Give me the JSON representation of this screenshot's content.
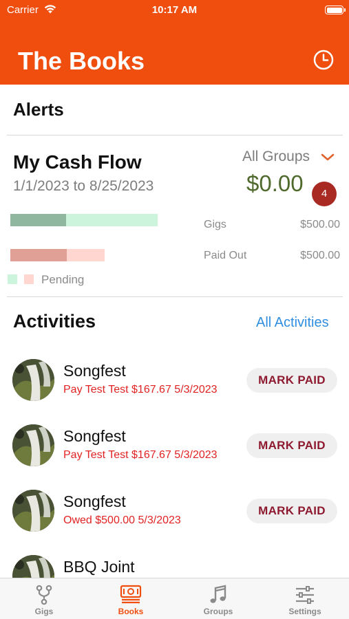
{
  "status_bar": {
    "carrier": "Carrier",
    "time": "10:17 AM"
  },
  "header": {
    "title": "The Books"
  },
  "alerts": {
    "label": "Alerts",
    "count": "4"
  },
  "cash_flow": {
    "title": "My Cash Flow",
    "date_range": "1/1/2023 to 8/25/2023",
    "group_filter": "All Groups",
    "amount": "$0.00",
    "rows": [
      {
        "label": "Gigs",
        "amount": "$500.00",
        "bar_fraction": 1.0,
        "settled_fraction": 0.38,
        "settled_color": "#8fb79f",
        "pending_color": "#ccf3dc"
      },
      {
        "label": "Paid Out",
        "amount": "$500.00",
        "bar_fraction": 0.64,
        "settled_fraction": 0.6,
        "settled_color": "#e0a095",
        "pending_color": "#ffd6d0"
      }
    ],
    "legend": {
      "label": "Pending",
      "colors": [
        "#ccf3dc",
        "#ffd6d0"
      ]
    }
  },
  "activities": {
    "title": "Activities",
    "link": "All Activities",
    "items": [
      {
        "name": "Songfest",
        "detail": "Pay Test Test $167.67 5/3/2023",
        "action": "MARK PAID"
      },
      {
        "name": "Songfest",
        "detail": "Pay Test Test $167.67 5/3/2023",
        "action": "MARK PAID"
      },
      {
        "name": "Songfest",
        "detail": "Owed $500.00 5/3/2023",
        "action": "MARK PAID"
      },
      {
        "name": "BBQ Joint",
        "detail": "",
        "action": ""
      }
    ]
  },
  "tabbar": {
    "tabs": [
      {
        "label": "Gigs",
        "icon": "branch-icon"
      },
      {
        "label": "Books",
        "icon": "cash-icon"
      },
      {
        "label": "Groups",
        "icon": "music-note-icon"
      },
      {
        "label": "Settings",
        "icon": "sliders-icon"
      }
    ],
    "active_index": 1,
    "active_color": "#f04e0f",
    "inactive_color": "#8a8a8a"
  }
}
